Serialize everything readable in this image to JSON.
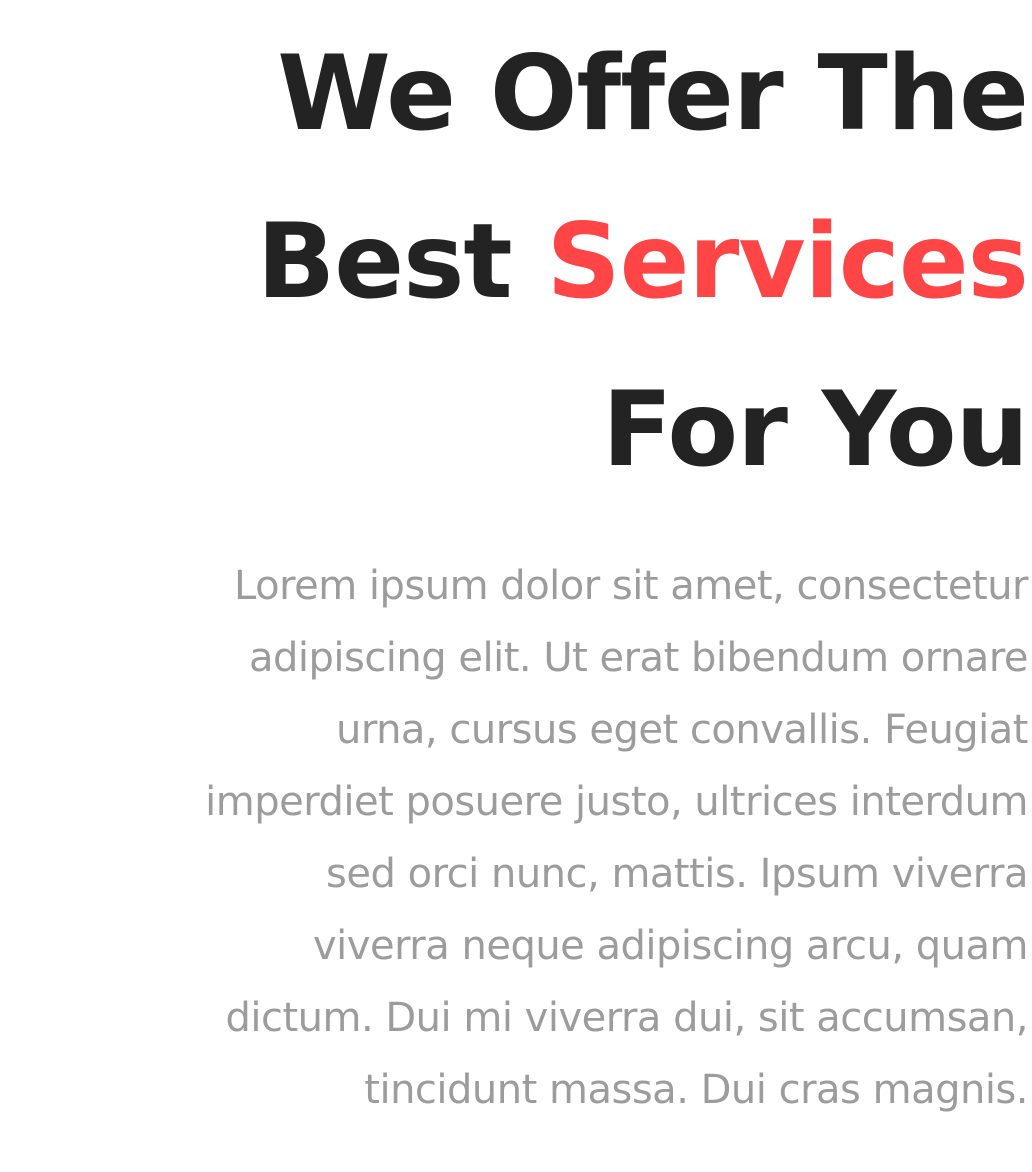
{
  "heading": {
    "line1": "We Offer The",
    "line2_prefix": "Best ",
    "line2_accent": "Services",
    "line3": "For You"
  },
  "description_lines": [
    "Lorem ipsum dolor sit amet, consectetur",
    "adipiscing elit. Ut erat bibendum ornare",
    "urna, cursus eget convallis. Feugiat",
    "imperdiet posuere justo, ultrices interdum",
    "sed orci nunc, mattis. Ipsum viverra",
    "viverra neque adipiscing arcu, quam",
    "dictum. Dui mi viverra dui, sit accumsan,",
    "tincidunt massa. Dui cras magnis."
  ],
  "colors": {
    "heading": "#232323",
    "accent": "#ff4545",
    "body": "#9c9c9c",
    "background": "#ffffff"
  }
}
